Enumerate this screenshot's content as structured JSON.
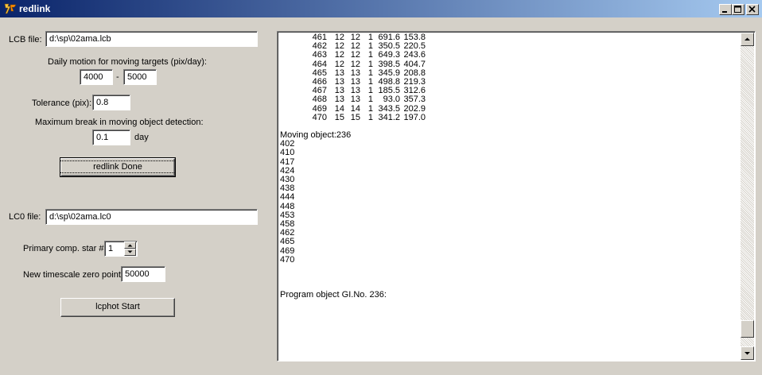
{
  "window": {
    "title": "redlink",
    "icons": {
      "app": "fox-app-icon",
      "minimize": "minimize-icon",
      "maximize": "maximize-icon",
      "close": "close-icon"
    }
  },
  "form": {
    "lcb_label": "LCB file:",
    "lcb_value": "d:\\sp\\02ama.lcb",
    "daily_motion_label": "Daily motion for moving targets (pix/day):",
    "motion_min": "4000",
    "motion_sep": "-",
    "motion_max": "5000",
    "tolerance_label": "Tolerance (pix):",
    "tolerance_value": "0.8",
    "max_break_label": "Maximum break in moving object detection:",
    "max_break_value": "0.1",
    "max_break_unit": "day",
    "redlink_button": "redlink Done",
    "lc0_label": "LC0 file:",
    "lc0_value": "d:\\sp\\02ama.lc0",
    "primary_label": "Primary comp. star #",
    "primary_value": "1",
    "zero_point_label": "New timescale zero point:",
    "zero_point_value": "50000",
    "lcphot_button": "lcphot Start"
  },
  "log": {
    "table_rows": [
      [
        "461",
        "12",
        "12",
        "1",
        "691.6",
        "153.8"
      ],
      [
        "462",
        "12",
        "12",
        "1",
        "350.5",
        "220.5"
      ],
      [
        "463",
        "12",
        "12",
        "1",
        "649.3",
        "243.6"
      ],
      [
        "464",
        "12",
        "12",
        "1",
        "398.5",
        "404.7"
      ],
      [
        "465",
        "13",
        "13",
        "1",
        "345.9",
        "208.8"
      ],
      [
        "466",
        "13",
        "13",
        "1",
        "498.8",
        "219.3"
      ],
      [
        "467",
        "13",
        "13",
        "1",
        "185.5",
        "312.6"
      ],
      [
        "468",
        "13",
        "13",
        "1",
        "93.0",
        "357.3"
      ],
      [
        "469",
        "14",
        "14",
        "1",
        "343.5",
        "202.9"
      ],
      [
        "470",
        "15",
        "15",
        "1",
        "341.2",
        "197.0"
      ]
    ],
    "moving_object_header": "Moving object:236",
    "moving_object_ids": [
      "402",
      "410",
      "417",
      "424",
      "430",
      "438",
      "444",
      "448",
      "453",
      "458",
      "462",
      "465",
      "469",
      "470"
    ],
    "program_object_line": "Program object GI.No. 236:",
    "scrollbar_icons": {
      "up": "scroll-up-arrow-icon",
      "down": "scroll-down-arrow-icon"
    },
    "scroll_position": 0.97
  }
}
